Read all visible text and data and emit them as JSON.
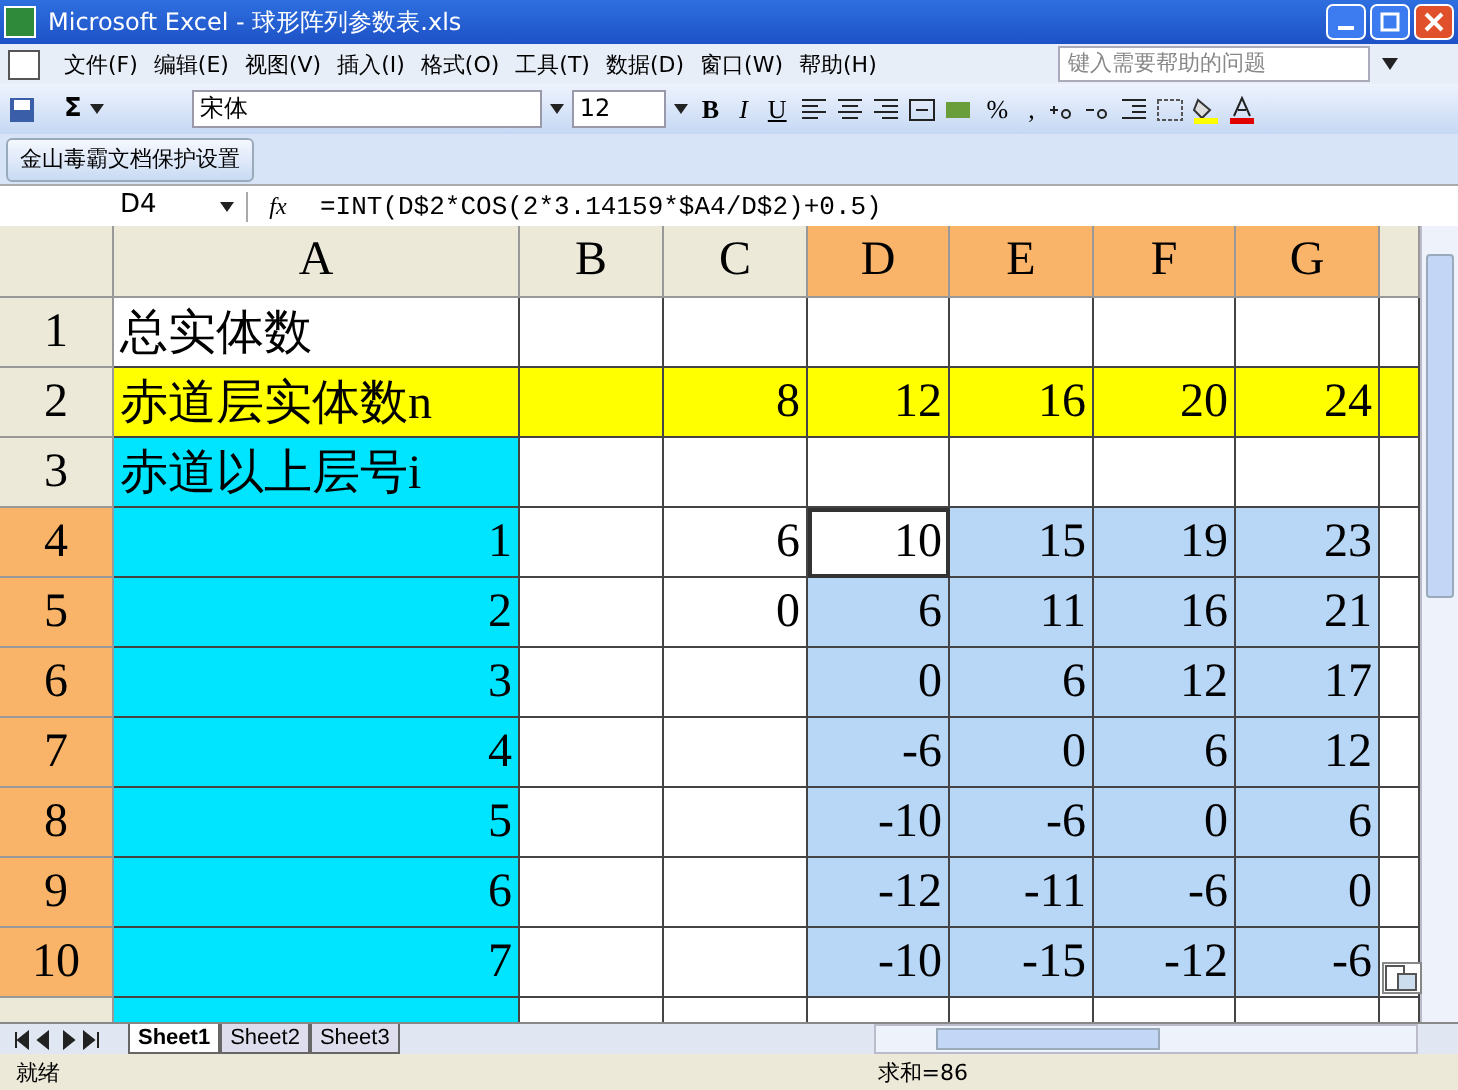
{
  "window": {
    "title": "Microsoft Excel - 球形阵列参数表.xls"
  },
  "menu": [
    "文件(F)",
    "编辑(E)",
    "视图(V)",
    "插入(I)",
    "格式(O)",
    "工具(T)",
    "数据(D)",
    "窗口(W)",
    "帮助(H)"
  ],
  "help_box": {
    "placeholder": "键入需要帮助的问题"
  },
  "toolbar": {
    "autosum": "Σ",
    "font": "宋体",
    "size": "12",
    "bold": "B",
    "italic": "I",
    "underline": "U",
    "percent": "%",
    "comma": ","
  },
  "addin_toolbar": {
    "button": "金山毒霸文档保护设置"
  },
  "formula_bar": {
    "name_box": "D4",
    "fx": "fx",
    "formula": "=INT(D$2*COS(2*3.14159*$A4/D$2)+0.5)"
  },
  "columns": [
    {
      "label": "A",
      "selected": false
    },
    {
      "label": "B",
      "selected": false
    },
    {
      "label": "C",
      "selected": false
    },
    {
      "label": "D",
      "selected": true
    },
    {
      "label": "E",
      "selected": true
    },
    {
      "label": "F",
      "selected": true
    },
    {
      "label": "G",
      "selected": true
    }
  ],
  "rows": [
    {
      "header": "1",
      "selected": false,
      "cells": [
        {
          "kind": "text",
          "text": "总实体数"
        },
        {},
        {},
        {},
        {},
        {},
        {},
        {}
      ]
    },
    {
      "header": "2",
      "selected": false,
      "cells": [
        {
          "kind": "text",
          "text": "赤道层实体数n",
          "color": "#ffff00"
        },
        {
          "color": "#ffff00"
        },
        {
          "kind": "number",
          "text": "8",
          "color": "#ffff00"
        },
        {
          "kind": "number",
          "text": "12",
          "color": "#ffff00"
        },
        {
          "kind": "number",
          "text": "16",
          "color": "#ffff00"
        },
        {
          "kind": "number",
          "text": "20",
          "color": "#ffff00"
        },
        {
          "kind": "number",
          "text": "24",
          "color": "#ffff00"
        },
        {
          "color": "#ffff00"
        }
      ]
    },
    {
      "header": "3",
      "selected": false,
      "cells": [
        {
          "kind": "text",
          "text": "赤道以上层号i",
          "color": "#00e5ff"
        },
        {},
        {},
        {},
        {},
        {},
        {},
        {}
      ]
    },
    {
      "header": "4",
      "selected": true,
      "cells": [
        {
          "kind": "number",
          "text": "1",
          "color": "#00e5ff"
        },
        {},
        {
          "kind": "number",
          "text": "6"
        },
        {
          "kind": "number",
          "text": "10",
          "active": true
        },
        {
          "kind": "number",
          "text": "15",
          "selected": true
        },
        {
          "kind": "number",
          "text": "19",
          "selected": true
        },
        {
          "kind": "number",
          "text": "23",
          "selected": true
        },
        {}
      ]
    },
    {
      "header": "5",
      "selected": true,
      "cells": [
        {
          "kind": "number",
          "text": "2",
          "color": "#00e5ff"
        },
        {},
        {
          "kind": "number",
          "text": "0"
        },
        {
          "kind": "number",
          "text": "6",
          "selected": true
        },
        {
          "kind": "number",
          "text": "11",
          "selected": true
        },
        {
          "kind": "number",
          "text": "16",
          "selected": true
        },
        {
          "kind": "number",
          "text": "21",
          "selected": true
        },
        {}
      ]
    },
    {
      "header": "6",
      "selected": true,
      "cells": [
        {
          "kind": "number",
          "text": "3",
          "color": "#00e5ff"
        },
        {},
        {},
        {
          "kind": "number",
          "text": "0",
          "selected": true
        },
        {
          "kind": "number",
          "text": "6",
          "selected": true
        },
        {
          "kind": "number",
          "text": "12",
          "selected": true
        },
        {
          "kind": "number",
          "text": "17",
          "selected": true
        },
        {}
      ]
    },
    {
      "header": "7",
      "selected": true,
      "cells": [
        {
          "kind": "number",
          "text": "4",
          "color": "#00e5ff"
        },
        {},
        {},
        {
          "kind": "number",
          "text": "-6",
          "selected": true
        },
        {
          "kind": "number",
          "text": "0",
          "selected": true
        },
        {
          "kind": "number",
          "text": "6",
          "selected": true
        },
        {
          "kind": "number",
          "text": "12",
          "selected": true
        },
        {}
      ]
    },
    {
      "header": "8",
      "selected": true,
      "cells": [
        {
          "kind": "number",
          "text": "5",
          "color": "#00e5ff"
        },
        {},
        {},
        {
          "kind": "number",
          "text": "-10",
          "selected": true
        },
        {
          "kind": "number",
          "text": "-6",
          "selected": true
        },
        {
          "kind": "number",
          "text": "0",
          "selected": true
        },
        {
          "kind": "number",
          "text": "6",
          "selected": true
        },
        {}
      ]
    },
    {
      "header": "9",
      "selected": true,
      "cells": [
        {
          "kind": "number",
          "text": "6",
          "color": "#00e5ff"
        },
        {},
        {},
        {
          "kind": "number",
          "text": "-12",
          "selected": true
        },
        {
          "kind": "number",
          "text": "-11",
          "selected": true
        },
        {
          "kind": "number",
          "text": "-6",
          "selected": true
        },
        {
          "kind": "number",
          "text": "0",
          "selected": true
        },
        {}
      ]
    },
    {
      "header": "10",
      "selected": true,
      "cells": [
        {
          "kind": "number",
          "text": "7",
          "color": "#00e5ff"
        },
        {},
        {},
        {
          "kind": "number",
          "text": "-10",
          "selected": true
        },
        {
          "kind": "number",
          "text": "-15",
          "selected": true
        },
        {
          "kind": "number",
          "text": "-12",
          "selected": true
        },
        {
          "kind": "number",
          "text": "-6",
          "selected": true
        },
        {}
      ]
    },
    {
      "selected": false,
      "cells": [
        {
          "color": "#00e5ff"
        },
        {},
        {},
        {},
        {},
        {},
        {},
        {}
      ]
    }
  ],
  "sheet_tabs": [
    {
      "label": "Sheet1",
      "selected": true
    },
    {
      "label": "Sheet2",
      "selected": false
    },
    {
      "label": "Sheet3",
      "selected": false
    }
  ],
  "status_bar": {
    "status": "就绪",
    "sum": "求和=86"
  }
}
